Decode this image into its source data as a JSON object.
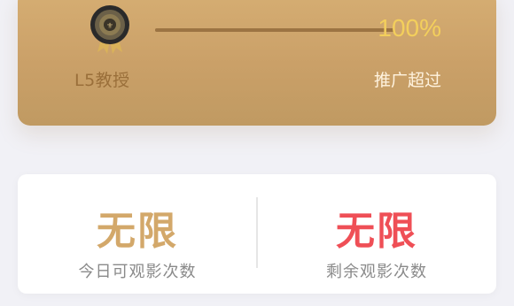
{
  "level_card": {
    "level_label": "L5教授",
    "progress_percent_text": "100%",
    "progress_fraction": 1.0,
    "progress_caption": "推广超过",
    "badge_icon": "level-medal-icon"
  },
  "stats": {
    "today_viewable": {
      "value": "无限",
      "label": "今日可观影次数",
      "color": "#d3a86a"
    },
    "remaining_views": {
      "value": "无限",
      "label": "剩余观影次数",
      "color": "#ef4f56"
    }
  }
}
